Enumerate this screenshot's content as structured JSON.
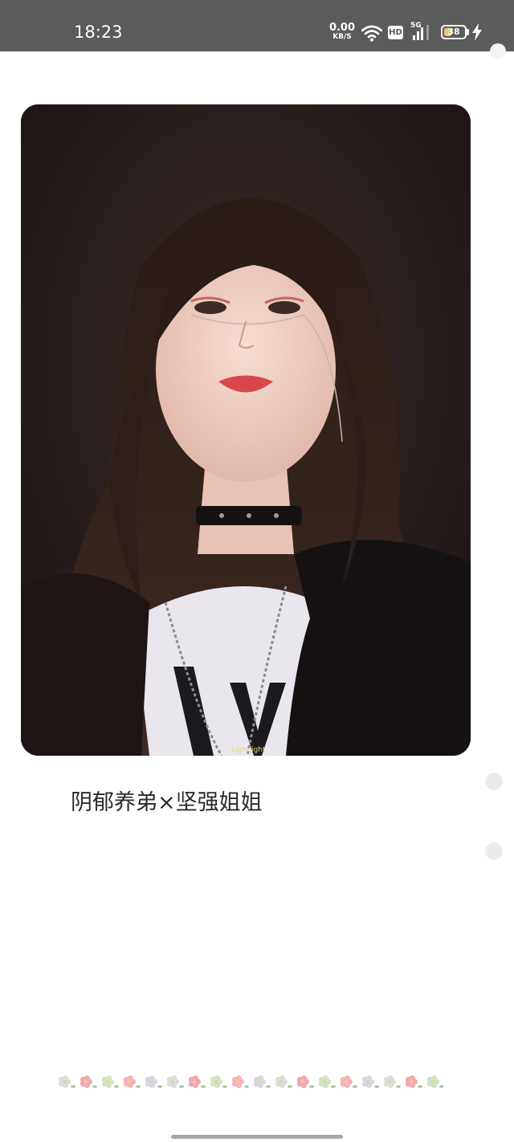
{
  "status_bar": {
    "time": "18:23",
    "net_speed_value": "0.00",
    "net_speed_unit": "KB/S",
    "hd_label": "HD",
    "network_type": "5G",
    "battery_level": "38",
    "battery_fraction": 0.38,
    "wifi_icon": "wifi-icon",
    "signal_icon": "signal-bars-icon",
    "charging_icon": "lightning-bolt-icon",
    "background_color": "#5b5b5b",
    "battery_fill_color": "#e7c489"
  },
  "content": {
    "photo_alt": "portrait photo",
    "caption": "阴郁养弟×坚强姐姐",
    "photo_watermark": "Lightlight",
    "decoration_icon": "flower-border-icon"
  }
}
